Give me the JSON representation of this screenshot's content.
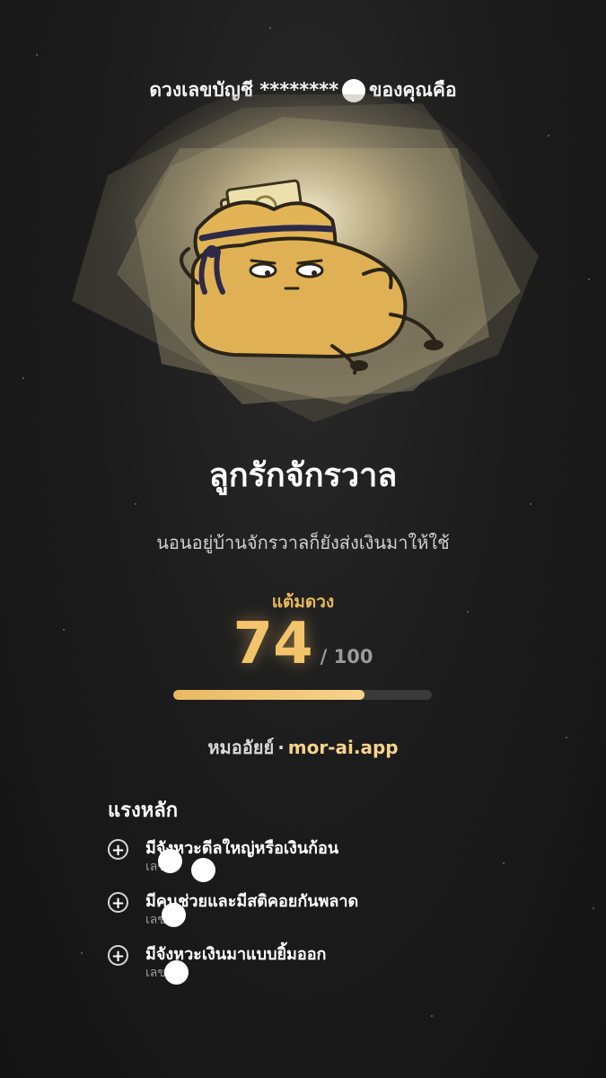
{
  "header": {
    "prefix": "ดวงเลขบัญชี ********",
    "suffix": "ของคุณคือ"
  },
  "result": {
    "title": "ลูกรักจักรวาล",
    "tagline": "นอนอยู่บ้านจักรวาลก็ยังส่งเงินมาให้ใช้"
  },
  "score": {
    "label": "แต้มดวง",
    "value": "74",
    "max": "/ 100",
    "fraction": 0.74
  },
  "brand": {
    "name": "หมออัยย์",
    "separator": "·",
    "url": "mor-ai.app"
  },
  "factors": {
    "title": "แรงหลัก",
    "items": [
      {
        "label": "มีจังหวะดีลใหญ่หรือเงินก้อน",
        "sub": "เลข",
        "icon": "plus-circle-icon"
      },
      {
        "label": "มีคนช่วยและมีสติคอยกันพลาด",
        "sub": "เลข",
        "icon": "plus-circle-icon"
      },
      {
        "label": "มีจังหวะเงินมาแบบยิ้มออก",
        "sub": "เลข",
        "icon": "plus-circle-icon"
      }
    ]
  },
  "colors": {
    "accent": "#f3c46c",
    "background": "#1c1c1c"
  }
}
